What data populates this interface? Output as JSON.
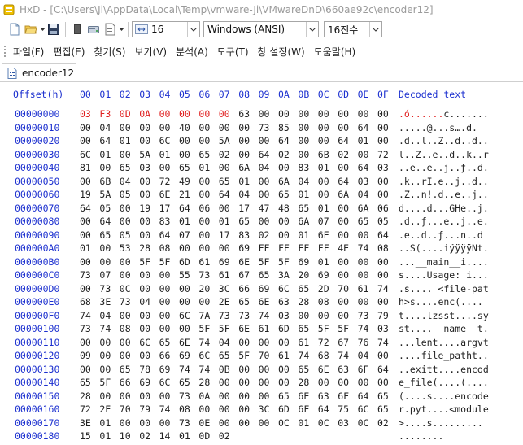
{
  "window": {
    "title": "HxD - [C:\\Users\\Ji\\AppData\\Local\\Temp\\vmware-Ji\\VMwareDnD\\660ae92c\\encoder12]"
  },
  "toolbar": {
    "bytes_per_row": "16",
    "charset": "Windows (ANSI)",
    "offset_base": "16진수"
  },
  "menu": {
    "items": [
      "파일(F)",
      "편집(E)",
      "찾기(S)",
      "보기(V)",
      "분석(A)",
      "도구(T)",
      "창 설정(W)",
      "도움말(H)"
    ]
  },
  "tab": {
    "label": "encoder12"
  },
  "editor": {
    "header_offset": "Offset(h)",
    "header_cols": [
      "00",
      "01",
      "02",
      "03",
      "04",
      "05",
      "06",
      "07",
      "08",
      "09",
      "0A",
      "0B",
      "0C",
      "0D",
      "0E",
      "0F"
    ],
    "header_decoded": "Decoded text",
    "modified_color": "#e01f1f",
    "rows": [
      {
        "offset": "00000000",
        "bytes": [
          "03",
          "F3",
          "0D",
          "0A",
          "00",
          "00",
          "00",
          "00",
          "63",
          "00",
          "00",
          "00",
          "00",
          "00",
          "00",
          "00"
        ],
        "text": ".ó......c.......",
        "modified_count": 8
      },
      {
        "offset": "00000010",
        "bytes": [
          "00",
          "04",
          "00",
          "00",
          "00",
          "40",
          "00",
          "00",
          "00",
          "73",
          "85",
          "00",
          "00",
          "00",
          "64",
          "00"
        ],
        "text": ".....@...s….d.",
        "modified_count": 0
      },
      {
        "offset": "00000020",
        "bytes": [
          "00",
          "64",
          "01",
          "00",
          "6C",
          "00",
          "00",
          "5A",
          "00",
          "00",
          "64",
          "00",
          "00",
          "64",
          "01",
          "00"
        ],
        "text": ".d..l..Z..d..d..",
        "modified_count": 0
      },
      {
        "offset": "00000030",
        "bytes": [
          "6C",
          "01",
          "00",
          "5A",
          "01",
          "00",
          "65",
          "02",
          "00",
          "64",
          "02",
          "00",
          "6B",
          "02",
          "00",
          "72"
        ],
        "text": "l..Z..e..d..k..r",
        "modified_count": 0
      },
      {
        "offset": "00000040",
        "bytes": [
          "81",
          "00",
          "65",
          "03",
          "00",
          "65",
          "01",
          "00",
          "6A",
          "04",
          "00",
          "83",
          "01",
          "00",
          "64",
          "03"
        ],
        "text": "..e..e..j..ƒ..d.",
        "modified_count": 0
      },
      {
        "offset": "00000050",
        "bytes": [
          "00",
          "6B",
          "04",
          "00",
          "72",
          "49",
          "00",
          "65",
          "01",
          "00",
          "6A",
          "04",
          "00",
          "64",
          "03",
          "00"
        ],
        "text": ".k..rI.e..j..d..",
        "modified_count": 0
      },
      {
        "offset": "00000060",
        "bytes": [
          "19",
          "5A",
          "05",
          "00",
          "6E",
          "21",
          "00",
          "64",
          "04",
          "00",
          "65",
          "01",
          "00",
          "6A",
          "04",
          "00"
        ],
        "text": ".Z..n!.d..e..j..",
        "modified_count": 0
      },
      {
        "offset": "00000070",
        "bytes": [
          "64",
          "05",
          "00",
          "19",
          "17",
          "64",
          "06",
          "00",
          "17",
          "47",
          "48",
          "65",
          "01",
          "00",
          "6A",
          "06"
        ],
        "text": "d....d...GHe..j.",
        "modified_count": 0
      },
      {
        "offset": "00000080",
        "bytes": [
          "00",
          "64",
          "00",
          "00",
          "83",
          "01",
          "00",
          "01",
          "65",
          "00",
          "00",
          "6A",
          "07",
          "00",
          "65",
          "05"
        ],
        "text": ".d..ƒ...e..j..e.",
        "modified_count": 0
      },
      {
        "offset": "00000090",
        "bytes": [
          "00",
          "65",
          "05",
          "00",
          "64",
          "07",
          "00",
          "17",
          "83",
          "02",
          "00",
          "01",
          "6E",
          "00",
          "00",
          "64"
        ],
        "text": ".e..d..ƒ...n..d",
        "modified_count": 0
      },
      {
        "offset": "000000A0",
        "bytes": [
          "01",
          "00",
          "53",
          "28",
          "08",
          "00",
          "00",
          "00",
          "69",
          "FF",
          "FF",
          "FF",
          "FF",
          "4E",
          "74",
          "08"
        ],
        "text": "..S(....iÿÿÿÿNt.",
        "modified_count": 0
      },
      {
        "offset": "000000B0",
        "bytes": [
          "00",
          "00",
          "00",
          "5F",
          "5F",
          "6D",
          "61",
          "69",
          "6E",
          "5F",
          "5F",
          "69",
          "01",
          "00",
          "00",
          "00"
        ],
        "text": "...__main__i....",
        "modified_count": 0
      },
      {
        "offset": "000000C0",
        "bytes": [
          "73",
          "07",
          "00",
          "00",
          "00",
          "55",
          "73",
          "61",
          "67",
          "65",
          "3A",
          "20",
          "69",
          "00",
          "00",
          "00"
        ],
        "text": "s....Usage: i...",
        "modified_count": 0
      },
      {
        "offset": "000000D0",
        "bytes": [
          "00",
          "73",
          "0C",
          "00",
          "00",
          "00",
          "20",
          "3C",
          "66",
          "69",
          "6C",
          "65",
          "2D",
          "70",
          "61",
          "74"
        ],
        "text": ".s.... <file-pat",
        "modified_count": 0
      },
      {
        "offset": "000000E0",
        "bytes": [
          "68",
          "3E",
          "73",
          "04",
          "00",
          "00",
          "00",
          "2E",
          "65",
          "6E",
          "63",
          "28",
          "08",
          "00",
          "00",
          "00"
        ],
        "text": "h>s....enc(....",
        "modified_count": 0
      },
      {
        "offset": "000000F0",
        "bytes": [
          "74",
          "04",
          "00",
          "00",
          "00",
          "6C",
          "7A",
          "73",
          "73",
          "74",
          "03",
          "00",
          "00",
          "00",
          "73",
          "79"
        ],
        "text": "t....lzsst....sy",
        "modified_count": 0
      },
      {
        "offset": "00000100",
        "bytes": [
          "73",
          "74",
          "08",
          "00",
          "00",
          "00",
          "5F",
          "5F",
          "6E",
          "61",
          "6D",
          "65",
          "5F",
          "5F",
          "74",
          "03"
        ],
        "text": "st....__name__t.",
        "modified_count": 0
      },
      {
        "offset": "00000110",
        "bytes": [
          "00",
          "00",
          "00",
          "6C",
          "65",
          "6E",
          "74",
          "04",
          "00",
          "00",
          "00",
          "61",
          "72",
          "67",
          "76",
          "74"
        ],
        "text": "...lent....argvt",
        "modified_count": 0
      },
      {
        "offset": "00000120",
        "bytes": [
          "09",
          "00",
          "00",
          "00",
          "66",
          "69",
          "6C",
          "65",
          "5F",
          "70",
          "61",
          "74",
          "68",
          "74",
          "04",
          "00"
        ],
        "text": "....file_patht..",
        "modified_count": 0
      },
      {
        "offset": "00000130",
        "bytes": [
          "00",
          "00",
          "65",
          "78",
          "69",
          "74",
          "74",
          "0B",
          "00",
          "00",
          "00",
          "65",
          "6E",
          "63",
          "6F",
          "64"
        ],
        "text": "..exitt....encod",
        "modified_count": 0
      },
      {
        "offset": "00000140",
        "bytes": [
          "65",
          "5F",
          "66",
          "69",
          "6C",
          "65",
          "28",
          "00",
          "00",
          "00",
          "00",
          "28",
          "00",
          "00",
          "00",
          "00"
        ],
        "text": "e_file(....(....",
        "modified_count": 0
      },
      {
        "offset": "00000150",
        "bytes": [
          "28",
          "00",
          "00",
          "00",
          "00",
          "73",
          "0A",
          "00",
          "00",
          "00",
          "65",
          "6E",
          "63",
          "6F",
          "64",
          "65"
        ],
        "text": "(....s....encode",
        "modified_count": 0
      },
      {
        "offset": "00000160",
        "bytes": [
          "72",
          "2E",
          "70",
          "79",
          "74",
          "08",
          "00",
          "00",
          "00",
          "3C",
          "6D",
          "6F",
          "64",
          "75",
          "6C",
          "65"
        ],
        "text": "r.pyt....<module",
        "modified_count": 0
      },
      {
        "offset": "00000170",
        "bytes": [
          "3E",
          "01",
          "00",
          "00",
          "00",
          "73",
          "0E",
          "00",
          "00",
          "00",
          "0C",
          "01",
          "0C",
          "03",
          "0C",
          "02"
        ],
        "text": ">....s.........",
        "modified_count": 0
      },
      {
        "offset": "00000180",
        "bytes": [
          "15",
          "01",
          "10",
          "02",
          "14",
          "01",
          "0D",
          "02"
        ],
        "text": "........",
        "modified_count": 0
      }
    ]
  }
}
